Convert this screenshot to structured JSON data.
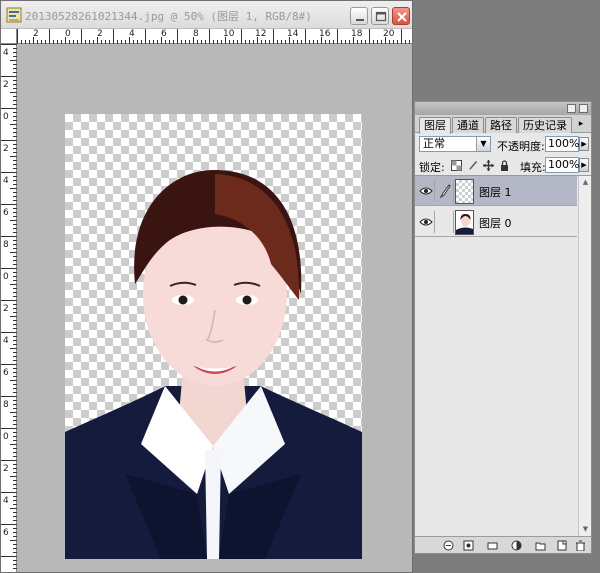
{
  "document": {
    "title": "20130528261021344.jpg @ 50% (图层 1, RGB/8#)",
    "ruler_top_labels": [
      "2",
      "0",
      "2",
      "4",
      "6",
      "8",
      "10",
      "12",
      "14",
      "16",
      "18",
      "20"
    ],
    "ruler_left_labels": [
      "4",
      "2",
      "0",
      "2",
      "4",
      "6",
      "8",
      "0",
      "2",
      "4",
      "6",
      "8",
      "0",
      "2",
      "4",
      "6"
    ]
  },
  "layers_panel": {
    "tabs": [
      {
        "label": "图层",
        "active": true
      },
      {
        "label": "通道",
        "active": false
      },
      {
        "label": "路径",
        "active": false
      },
      {
        "label": "历史记录",
        "active": false
      }
    ],
    "blend_mode": "正常",
    "opacity_label": "不透明度:",
    "opacity_value": "100%",
    "lock_label": "锁定:",
    "fill_label": "填充:",
    "fill_value": "100%",
    "layers": [
      {
        "name": "图层 1",
        "selected": true,
        "visible": true
      },
      {
        "name": "图层 0",
        "selected": false,
        "visible": true
      }
    ]
  },
  "icons": {
    "app": "photoshop-doc-icon",
    "minimize": "minimize-icon",
    "maximize": "maximize-icon",
    "close": "close-icon"
  },
  "colors": {
    "workspace": "#b8b8b8",
    "selected_layer": "#b3b7c6",
    "suit": "#141b3d",
    "hair": "#3a1410"
  }
}
